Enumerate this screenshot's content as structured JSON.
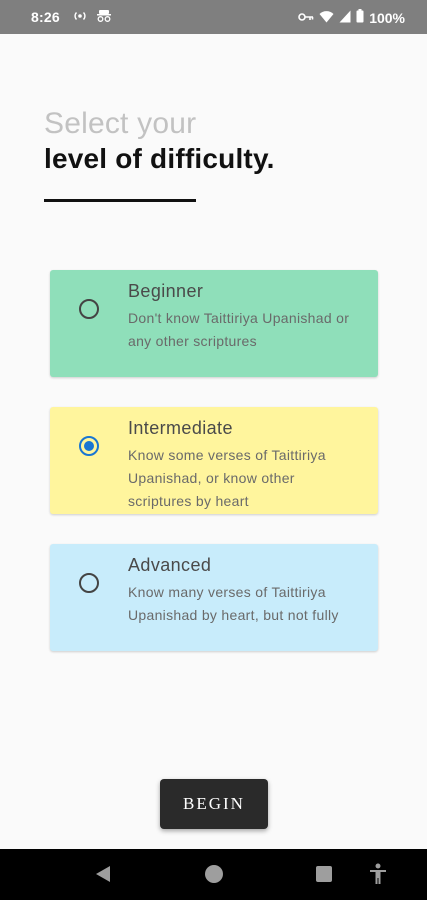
{
  "status_bar": {
    "time": "8:26",
    "battery": "100%",
    "left_icons": [
      "broadcast-icon",
      "incognito-icon"
    ],
    "right_icons": [
      "vpn-key-icon",
      "wifi-icon",
      "signal-icon",
      "battery-icon"
    ]
  },
  "header": {
    "line1": "Select your",
    "line2": "level of difficulty."
  },
  "options": [
    {
      "title": "Beginner",
      "description": "Don't know Taittiriya Upanishad or any other scriptures",
      "selected": false,
      "color": "#8fdfba"
    },
    {
      "title": "Intermediate",
      "description": "Know some verses of Taittiriya Upanishad, or know other scriptures by heart",
      "selected": true,
      "color": "#fff59d"
    },
    {
      "title": "Advanced",
      "description": "Know many verses of Taittiriya Upanishad by heart, but not fully",
      "selected": false,
      "color": "#c8ecfb"
    }
  ],
  "begin_button": {
    "label": "BEGIN"
  },
  "nav_bar": {
    "icons": [
      "back-icon",
      "home-icon",
      "recents-icon",
      "accessibility-icon"
    ]
  },
  "colors": {
    "radio_selected": "#1976d2",
    "button_bg": "#2a2a2a"
  }
}
